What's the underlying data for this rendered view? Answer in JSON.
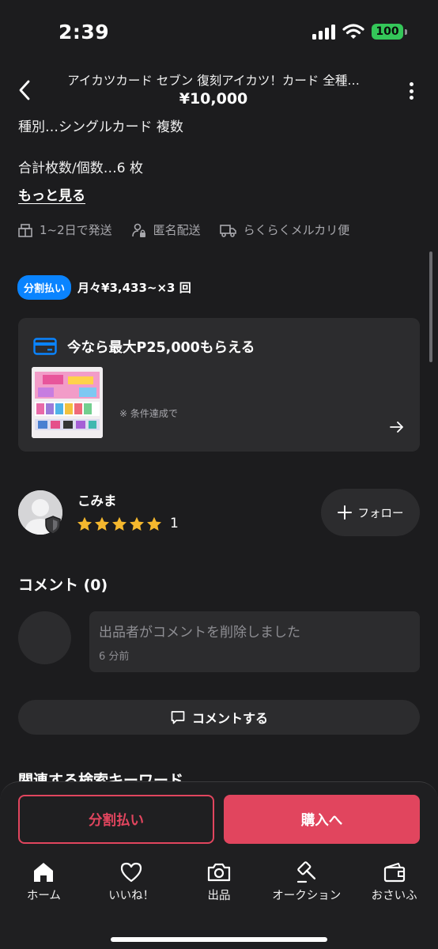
{
  "status_bar": {
    "time": "2:39",
    "battery": "100"
  },
  "header": {
    "title": "アイカツカード セブン 復刻アイカツ！カード 全種…",
    "price": "¥10,000"
  },
  "description": {
    "lines": [
      "種別…シングルカード 複数",
      "合計枚数/個数…6 枚"
    ],
    "more_link": "もっと見る"
  },
  "shipping": {
    "items": [
      {
        "icon": "box-icon",
        "label": "1~2日で発送"
      },
      {
        "icon": "anonymous-person-icon",
        "label": "匿名配送"
      },
      {
        "icon": "truck-icon",
        "label": "らくらくメルカリ便"
      }
    ]
  },
  "installment": {
    "badge": "分割払い",
    "text": "月々¥3,433~×3 回"
  },
  "promo": {
    "title": "今なら最大P25,000もらえる",
    "note": "※ 条件達成で"
  },
  "seller": {
    "name": "こみま",
    "rating": 5,
    "review_count": "1",
    "follow_label": "フォロー"
  },
  "comments": {
    "heading": "コメント (0)",
    "items": [
      {
        "text": "出品者がコメントを削除しました",
        "time": "6 分前"
      }
    ],
    "write_label": "コメントする"
  },
  "related": {
    "heading": "関連する検索キーワード"
  },
  "actions": {
    "split_label": "分割払い",
    "buy_label": "購入へ"
  },
  "tabs": [
    {
      "label": "ホーム",
      "icon": "home-icon"
    },
    {
      "label": "いいね！",
      "icon": "heart-icon"
    },
    {
      "label": "出品",
      "icon": "camera-icon"
    },
    {
      "label": "オークション",
      "icon": "gavel-icon"
    },
    {
      "label": "おさいふ",
      "icon": "wallet-icon"
    }
  ],
  "colors": {
    "accent": "#e1455e",
    "installment_badge": "#0a84ff",
    "star": "#f5b82e",
    "background": "#1c1c1e",
    "card": "#2c2c2e"
  }
}
